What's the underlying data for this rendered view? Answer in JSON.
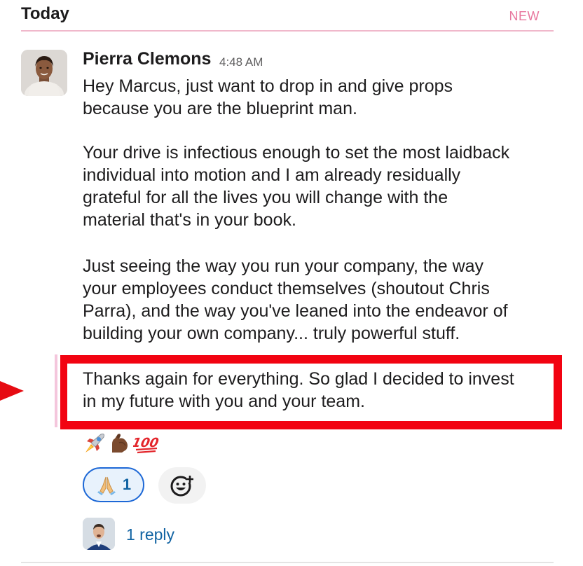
{
  "header": {
    "day_label": "Today",
    "new_label": "NEW"
  },
  "message": {
    "sender": "Pierra Clemons",
    "time": "4:48 AM",
    "paragraphs": [
      "Hey Marcus, just want to drop in and give props\nbecause you are the blueprint man.",
      "Your drive is infectious enough to set the most laidback\nindividual into motion and I am already residually\ngrateful for all the lives you will change with the\nmaterial that's in your book.",
      "Just seeing the way you run your company, the way\nyour employees conduct themselves (shoutout Chris\nParra), and the way you've leaned into the endeavor of\nbuilding your own company... truly powerful stuff.",
      "Thanks again for everything. So glad I decided to invest\nin my future with you and your team."
    ],
    "emojis": [
      "rocket-icon",
      "flexed-biceps-icon",
      "hundred-points-icon"
    ]
  },
  "reactions": [
    {
      "icon": "folded-hands-icon",
      "count": "1"
    }
  ],
  "add_reaction_icon": "add-reaction-icon",
  "thread": {
    "reply_text": "1 reply"
  },
  "colors": {
    "accent_new": "#e8779e",
    "highlight_red": "#f20311",
    "link_blue": "#1264a3",
    "reaction_border": "#1d68d6"
  }
}
